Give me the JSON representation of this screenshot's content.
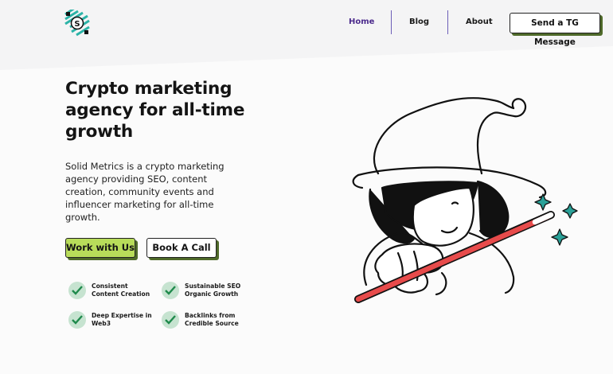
{
  "brand": {
    "logo_letter": "S",
    "logo_color": "#2bb3a7"
  },
  "nav": {
    "home": "Home",
    "blog": "Blog",
    "about": "About",
    "cta": "Send a TG Message",
    "accent": "#4b2a8c"
  },
  "hero": {
    "title_lines": [
      "Crypto marketing",
      "agency for all-time",
      "growth"
    ],
    "description": "Solid Metrics is a crypto marketing agency providing SEO, content creation, community events and influencer marketing for all-time growth.",
    "primary_button": "Work with Us",
    "secondary_button": "Book A Call",
    "primary_color": "#b8dc5a"
  },
  "features": [
    {
      "line1": "Consistent",
      "line2": "Content Creation"
    },
    {
      "line1": "Sustainable SEO",
      "line2": "Organic Growth"
    },
    {
      "line1": "Deep Expertise in",
      "line2": "Web3"
    },
    {
      "line1": "Backlinks from",
      "line2": "Credible Source"
    }
  ],
  "illustration": {
    "subject": "witch-with-magic-wand",
    "wand_color": "#e74b4b",
    "sparkle_color": "#2aa198"
  }
}
